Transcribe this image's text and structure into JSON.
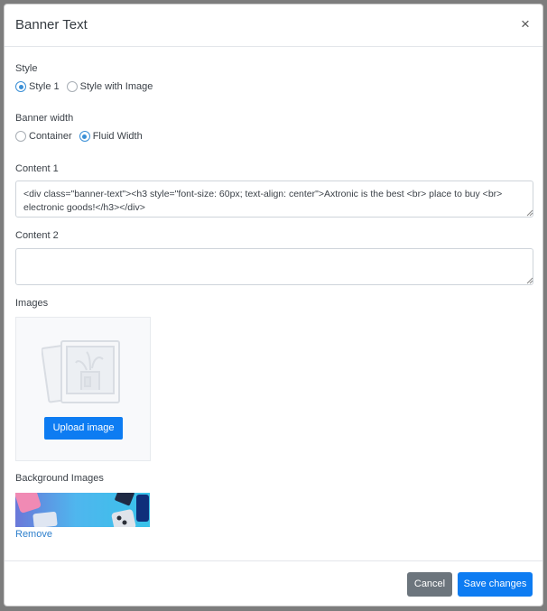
{
  "modal": {
    "title": "Banner Text",
    "close_symbol": "×"
  },
  "style": {
    "label": "Style",
    "options": [
      "Style 1",
      "Style with Image"
    ],
    "selected": "Style 1"
  },
  "banner_width": {
    "label": "Banner width",
    "options": [
      "Container",
      "Fluid Width"
    ],
    "selected": "Fluid Width"
  },
  "content1": {
    "label": "Content 1",
    "value": "<div class=\"banner-text\"><h3  style=\"font-size: 60px; text-align: center\">Axtronic is the best <br> place to buy <br> electronic goods!</h3></div>"
  },
  "content2": {
    "label": "Content 2",
    "value": ""
  },
  "images": {
    "label": "Images",
    "upload_label": "Upload image"
  },
  "background_images": {
    "label": "Background Images",
    "remove_label": "Remove"
  },
  "footer": {
    "cancel_label": "Cancel",
    "save_label": "Save changes"
  },
  "colors": {
    "primary": "#0d7cf2",
    "secondary": "#6c757d",
    "link": "#2d7fcc",
    "radio_checked": "#3a8fd6"
  },
  "icons": {
    "close": "close-icon",
    "placeholder": "image-placeholder-icon"
  }
}
